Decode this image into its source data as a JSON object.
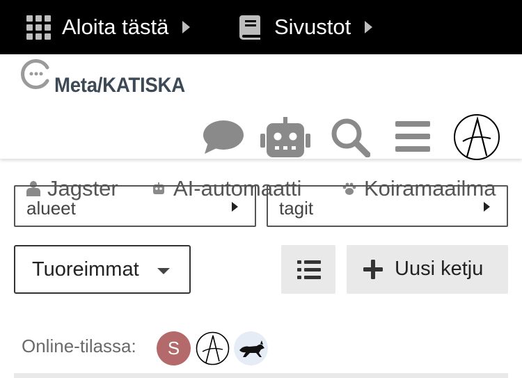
{
  "topbar": {
    "start_label": "Aloita tästä",
    "sites_label": "Sivustot"
  },
  "header": {
    "site_name": "Meta/KATISKA",
    "icons": [
      "chat-icon",
      "robot-icon",
      "search-icon",
      "hamburger-menu-icon",
      "user-avatar"
    ]
  },
  "categories": [
    {
      "label": "Jagster",
      "icon": "user-badge-icon"
    },
    {
      "label": "AI-automaatti",
      "icon": "robot-icon"
    },
    {
      "label": "Koiramaailma",
      "icon": "paw-icon"
    }
  ],
  "filters": {
    "categories_label": "alueet",
    "tags_label": "tagit"
  },
  "sort": {
    "selected": "Tuoreimmat"
  },
  "actions": {
    "new_topic_label": "Uusi ketju"
  },
  "online": {
    "label": "Online-tilassa:",
    "users": [
      {
        "initial": "S",
        "color": "#b46a6a"
      },
      {
        "initial": "",
        "icon": "anarchy-avatar"
      },
      {
        "initial": "",
        "icon": "dog-avatar"
      }
    ]
  },
  "colors": {
    "topbar_bg": "#000000",
    "icon_grey": "#8a8a8a",
    "logo_text": "#3d4a56",
    "button_grey": "#e9e9e9"
  }
}
